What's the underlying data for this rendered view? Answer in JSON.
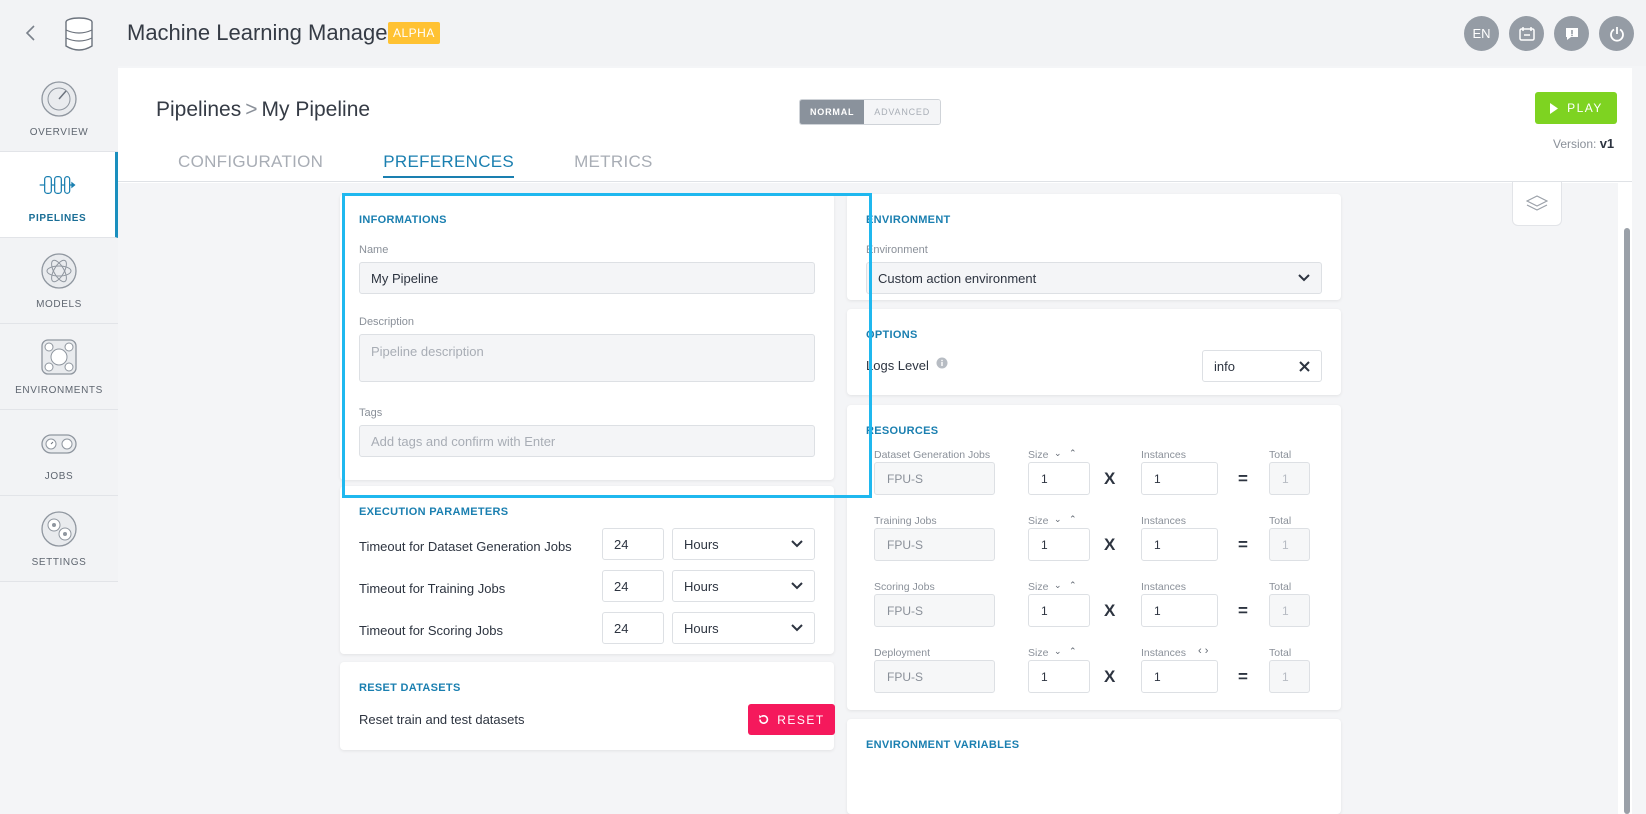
{
  "app": {
    "title": "Machine Learning Manager",
    "badge": "ALPHA"
  },
  "top_icons": {
    "language": "EN"
  },
  "sidebar": {
    "items": [
      {
        "label": "OVERVIEW"
      },
      {
        "label": "PIPELINES"
      },
      {
        "label": "MODELS"
      },
      {
        "label": "ENVIRONMENTS"
      },
      {
        "label": "JOBS"
      },
      {
        "label": "SETTINGS"
      }
    ]
  },
  "header": {
    "breadcrumb_root": "Pipelines",
    "breadcrumb_separator": ">",
    "breadcrumb_current": "My Pipeline",
    "mode_normal": "NORMAL",
    "mode_advanced": "ADVANCED",
    "play_label": "PLAY",
    "version_label": "Version:",
    "version_value": "v1",
    "tabs": [
      "CONFIGURATION",
      "PREFERENCES",
      "METRICS"
    ]
  },
  "informations": {
    "title": "INFORMATIONS",
    "name_label": "Name",
    "name_value": "My Pipeline",
    "description_label": "Description",
    "description_placeholder": "Pipeline description",
    "tags_label": "Tags",
    "tags_placeholder": "Add tags and confirm with Enter"
  },
  "execution": {
    "title": "EXECUTION PARAMETERS",
    "rows": [
      {
        "label": "Timeout for Dataset Generation Jobs",
        "value": "24",
        "unit": "Hours"
      },
      {
        "label": "Timeout for Training Jobs",
        "value": "24",
        "unit": "Hours"
      },
      {
        "label": "Timeout for Scoring Jobs",
        "value": "24",
        "unit": "Hours"
      }
    ]
  },
  "reset": {
    "title": "RESET DATASETS",
    "label": "Reset train and test datasets",
    "button": "RESET"
  },
  "environment": {
    "title": "ENVIRONMENT",
    "label": "Environment",
    "value": "Custom action environment"
  },
  "options": {
    "title": "OPTIONS",
    "logs_label": "Logs Level",
    "logs_value": "info"
  },
  "resources": {
    "title": "RESOURCES",
    "size_label": "Size",
    "instances_label": "Instances",
    "total_label": "Total",
    "multiply": "X",
    "equals": "=",
    "rows": [
      {
        "name": "Dataset Generation Jobs",
        "type": "FPU-S",
        "size": "1",
        "instances": "1",
        "total": "1"
      },
      {
        "name": "Training Jobs",
        "type": "FPU-S",
        "size": "1",
        "instances": "1",
        "total": "1"
      },
      {
        "name": "Scoring Jobs",
        "type": "FPU-S",
        "size": "1",
        "instances": "1",
        "total": "1"
      },
      {
        "name": "Deployment",
        "type": "FPU-S",
        "size": "1",
        "instances": "1",
        "total": "1"
      }
    ]
  },
  "env_vars": {
    "title": "ENVIRONMENT VARIABLES"
  },
  "colors": {
    "accent": "#1a7fb0",
    "highlight": "#1fb8ef",
    "play": "#7ed321",
    "reset": "#f5195c",
    "badge": "#ffc233"
  }
}
